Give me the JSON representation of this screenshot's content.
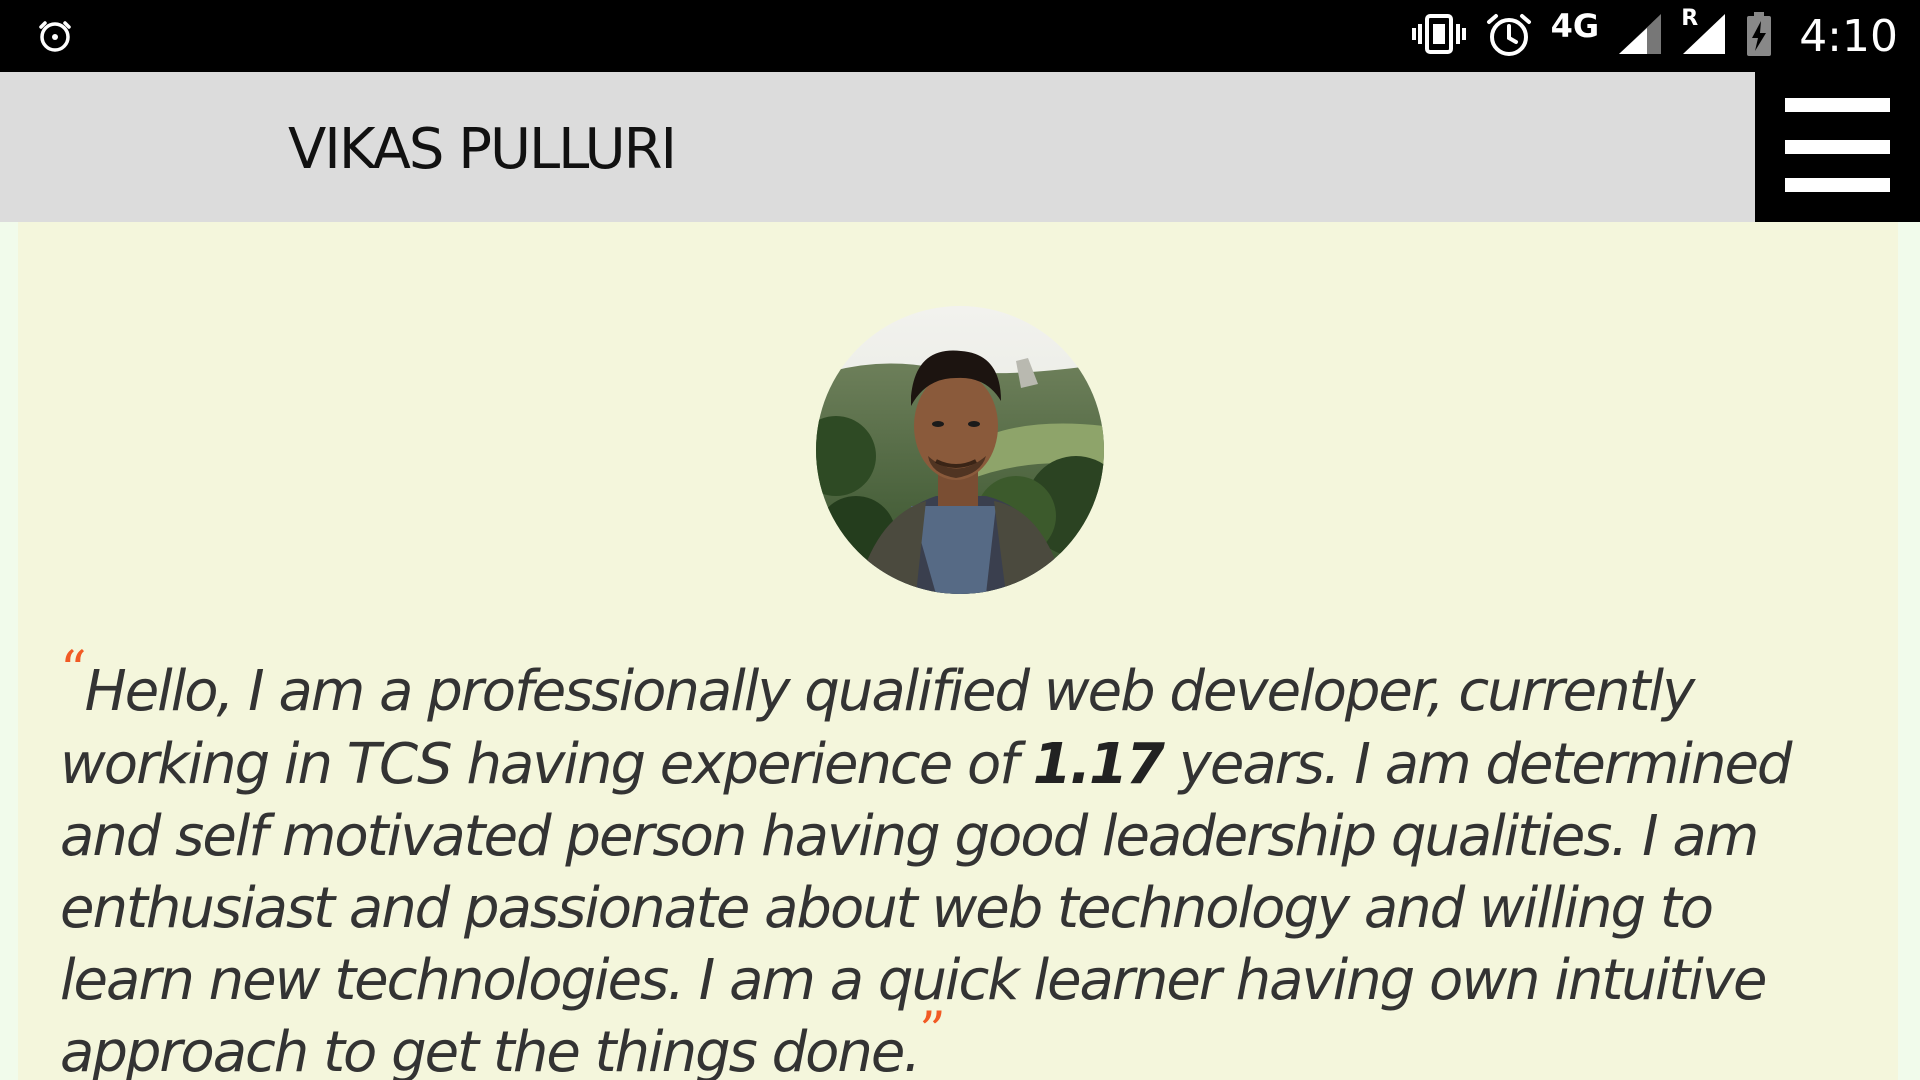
{
  "status_bar": {
    "left_icon": "alarm-icon",
    "icons": [
      "vibrate-icon",
      "alarm-clock-icon",
      "signal-icon",
      "roaming-signal-icon",
      "battery-charging-icon"
    ],
    "network": "4G",
    "roaming": "R",
    "time": "4:10"
  },
  "header": {
    "title": "VIKAS PULLURI",
    "menu_icon": "hamburger-menu-icon"
  },
  "profile": {
    "avatar_icon": "profile-photo"
  },
  "intro": {
    "open_quote": "“",
    "text_before": "Hello, I am a professionally qualified web developer, currently working in TCS having experience of ",
    "experience": "1.17",
    "text_after": " years. I am determined and self motivated person having good leadership qualities. I am enthusiast and passionate about web technology and willing to learn new technologies. I am a quick learner having own intuitive approach to get the things done.",
    "close_quote": "”"
  },
  "colors": {
    "page_background": "#f4f6dc",
    "header_background": "#dcdcdc",
    "menu_background": "#000000",
    "accent_quote": "#f15a24",
    "text": "#333333"
  }
}
